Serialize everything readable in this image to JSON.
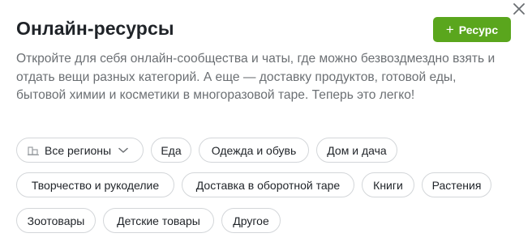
{
  "header": {
    "title": "Онлайн-ресурсы",
    "add_button_label": "Ресурс"
  },
  "description": "Откройте для себя онлайн-сообщества и чаты, где можно безвоздмездно взять и отдать вещи разных категорий. А еще — доставку продуктов, готовой еды, бытовой химии и косметики в многоразовой таре. Теперь это легко!",
  "filters": {
    "region_label": "Все регионы",
    "categories": [
      "Еда",
      "Одежда и обувь",
      "Дом и дача",
      "Творчество и рукоделие",
      "Доставка в оборотной таре",
      "Книги",
      "Растения",
      "Зоотовары",
      "Детские товары",
      "Другое"
    ]
  },
  "icons": {
    "close": "close-icon",
    "add": "plus-icon",
    "region": "building-icon",
    "dropdown": "chevron-down-icon"
  },
  "colors": {
    "accent": "#5aa61d",
    "text": "#1f2328",
    "muted_text": "#6b6f73",
    "chip_border": "#d3d6d9"
  }
}
